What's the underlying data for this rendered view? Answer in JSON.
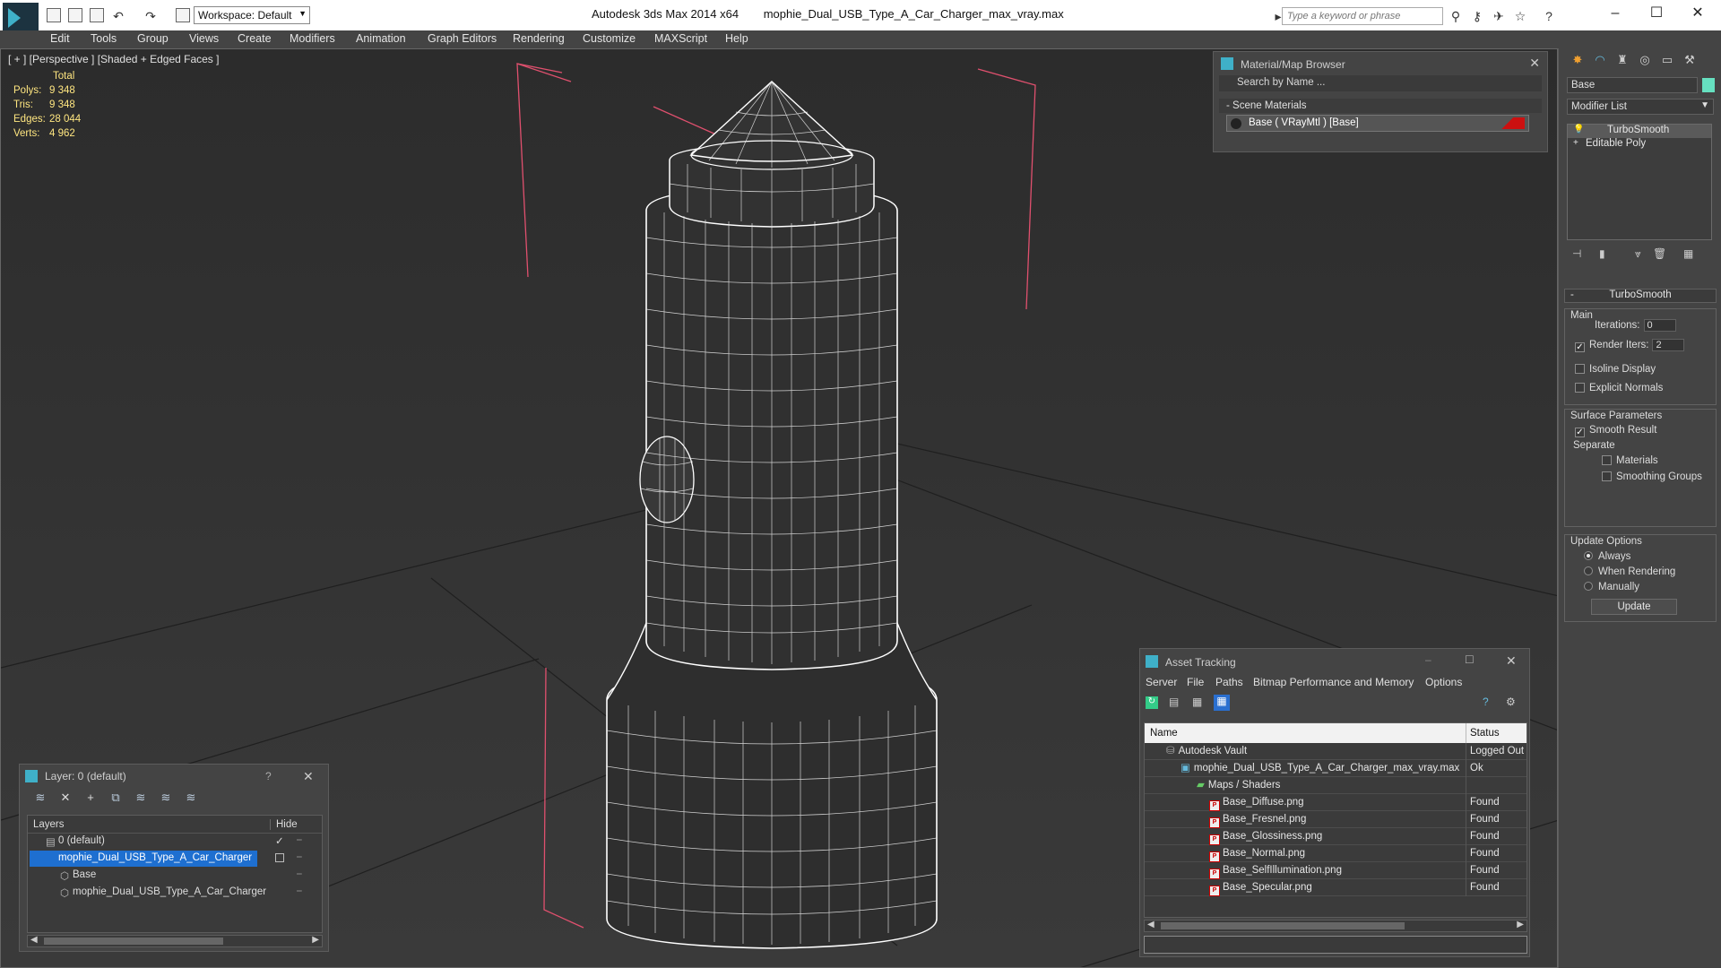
{
  "titlebar": {
    "app": "Autodesk 3ds Max  2014 x64",
    "file": "mophie_Dual_USB_Type_A_Car_Charger_max_vray.max",
    "workspace": "Workspace: Default",
    "search_placeholder": "Type a keyword or phrase"
  },
  "menu": [
    "Edit",
    "Tools",
    "Group",
    "Views",
    "Create",
    "Modifiers",
    "Animation",
    "Graph Editors",
    "Rendering",
    "Customize",
    "MAXScript",
    "Help"
  ],
  "viewport": {
    "label": "[ + ] [Perspective ] [Shaded + Edged Faces ]",
    "stats": {
      "header": "Total",
      "rows": [
        {
          "label": "Polys:",
          "value": "9 348"
        },
        {
          "label": "Tris:",
          "value": "9 348"
        },
        {
          "label": "Edges:",
          "value": "28 044"
        },
        {
          "label": "Verts:",
          "value": "4 962"
        }
      ]
    }
  },
  "material_browser": {
    "title": "Material/Map Browser",
    "search": "Search by Name ...",
    "section": "Scene Materials",
    "entry": "Base  ( VRayMtl )  [Base]"
  },
  "command_panel": {
    "object_name": "Base",
    "modifier_list": "Modifier List",
    "stack": [
      "TurboSmooth",
      "Editable Poly"
    ],
    "rollout_title": "TurboSmooth",
    "main_group": "Main",
    "iterations_label": "Iterations:",
    "iterations_value": "0",
    "render_iters_label": "Render Iters:",
    "render_iters_value": "2",
    "isoline": "Isoline Display",
    "explicit_normals": "Explicit Normals",
    "surface_group": "Surface Parameters",
    "smooth_result": "Smooth Result",
    "separate": "Separate",
    "materials": "Materials",
    "smoothing_groups": "Smoothing Groups",
    "update_group": "Update Options",
    "always": "Always",
    "when_rendering": "When Rendering",
    "manually": "Manually",
    "update_button": "Update"
  },
  "layers": {
    "title": "Layer: 0 (default)",
    "col_layers": "Layers",
    "col_hide": "Hide",
    "rows": [
      "0 (default)",
      "mophie_Dual_USB_Type_A_Car_Charger",
      "Base",
      "mophie_Dual_USB_Type_A_Car_Charger"
    ]
  },
  "asset_tracking": {
    "title": "Asset Tracking",
    "menu": [
      "Server",
      "File",
      "Paths",
      "Bitmap Performance and Memory",
      "Options"
    ],
    "col_name": "Name",
    "col_status": "Status",
    "rows": [
      {
        "name": "Autodesk Vault",
        "status": "Logged Out"
      },
      {
        "name": "mophie_Dual_USB_Type_A_Car_Charger_max_vray.max",
        "status": "Ok"
      },
      {
        "name": "Maps / Shaders",
        "status": ""
      },
      {
        "name": "Base_Diffuse.png",
        "status": "Found"
      },
      {
        "name": "Base_Fresnel.png",
        "status": "Found"
      },
      {
        "name": "Base_Glossiness.png",
        "status": "Found"
      },
      {
        "name": "Base_Normal.png",
        "status": "Found"
      },
      {
        "name": "Base_SelfIllumination.png",
        "status": "Found"
      },
      {
        "name": "Base_Specular.png",
        "status": "Found"
      }
    ]
  },
  "colors": {
    "stats_text": "#ffe680",
    "selection": "#1e6fd0",
    "bbox": "#e0506e",
    "accent": "#3fb0c8"
  }
}
